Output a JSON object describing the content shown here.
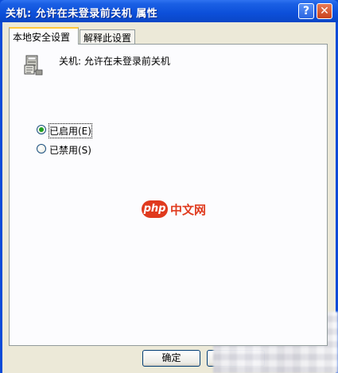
{
  "window": {
    "title": "关机: 允许在未登录前关机 属性",
    "help_glyph": "?",
    "close_glyph": "✕"
  },
  "tabs": [
    {
      "label": "本地安全设置",
      "active": true
    },
    {
      "label": "解释此设置",
      "active": false
    }
  ],
  "policy": {
    "name": "关机: 允许在未登录前关机",
    "icon": "computer-policy-icon"
  },
  "options": [
    {
      "label": "已启用(E)",
      "checked": true
    },
    {
      "label": "已禁用(S)",
      "checked": false
    }
  ],
  "buttons": {
    "ok_label": "确定"
  },
  "watermark": {
    "logo": "php",
    "text": "中文网"
  },
  "colors": {
    "titlebar": "#0c4fd9",
    "dialog_bg": "#ece9d8",
    "accent_tab": "#ffc73c",
    "radio_dot": "#21a121",
    "watermark": "#e03a1e"
  }
}
